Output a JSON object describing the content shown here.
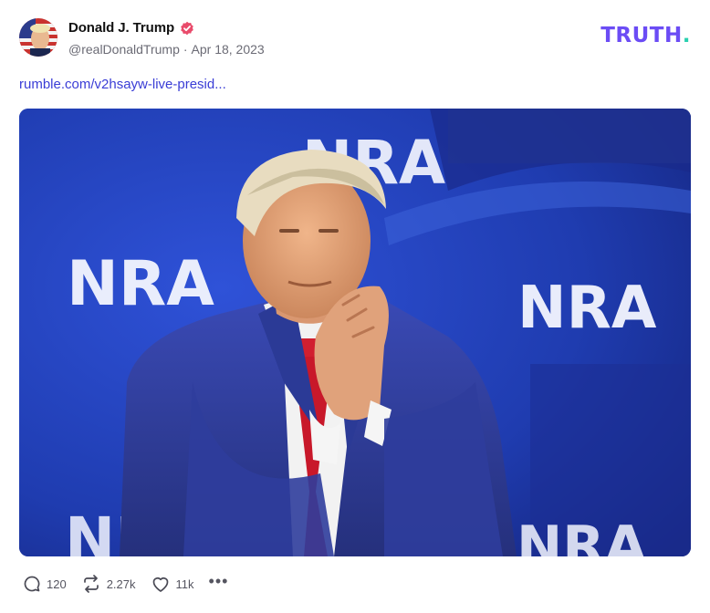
{
  "post": {
    "author": {
      "display_name": "Donald J. Trump",
      "handle": "@realDonaldTrump",
      "separator": "·",
      "date": "Apr 18, 2023",
      "verified": true,
      "verified_color": "#e94b6b"
    },
    "brand": {
      "logo_text": "TRUTH",
      "logo_dot": ".",
      "logo_color": "#6b4cf5",
      "logo_dot_color": "#2ad0b0"
    },
    "link_text": "rumble.com/v2hsayw-live-presid...",
    "link_color": "#3a3dd6",
    "media": {
      "banner_text": "NRA",
      "background_color": "#1b2f9a"
    },
    "actions": {
      "replies": "120",
      "retruths": "2.27k",
      "likes": "11k",
      "more": "•••"
    }
  }
}
